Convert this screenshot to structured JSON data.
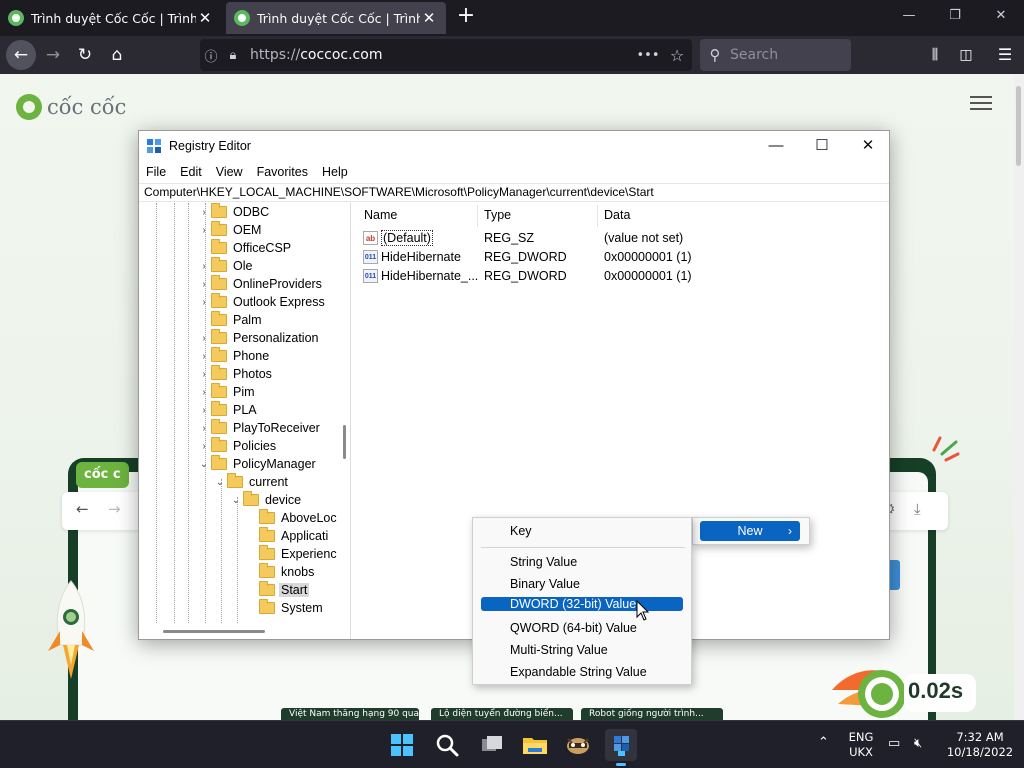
{
  "browser": {
    "tabs": [
      {
        "title": "Trình duyệt Cốc Cốc | Trình duy",
        "active": false
      },
      {
        "title": "Trình duyệt Cốc Cốc | Trình duy",
        "active": true
      }
    ],
    "url_scheme": "https://",
    "url_host": "coccoc.com",
    "search_placeholder": "Search"
  },
  "page": {
    "logo_text": "cốc cốc",
    "mock_logo": "cốc c",
    "speed_value": "0.02s",
    "news": [
      "Việt Nam thăng hạng 90 qua...",
      "Lộ diện tuyển đường biển...",
      "Robot giống người trình..."
    ]
  },
  "regedit": {
    "title": "Registry Editor",
    "menu": [
      "File",
      "Edit",
      "View",
      "Favorites",
      "Help"
    ],
    "address": "Computer\\HKEY_LOCAL_MACHINE\\SOFTWARE\\Microsoft\\PolicyManager\\current\\device\\Start",
    "tree": [
      {
        "label": "ODBC",
        "level": 0,
        "expander": "›"
      },
      {
        "label": "OEM",
        "level": 0,
        "expander": "›"
      },
      {
        "label": "OfficeCSP",
        "level": 0,
        "expander": ""
      },
      {
        "label": "Ole",
        "level": 0,
        "expander": "›"
      },
      {
        "label": "OnlineProviders",
        "level": 0,
        "expander": "›"
      },
      {
        "label": "Outlook Express",
        "level": 0,
        "expander": "›"
      },
      {
        "label": "Palm",
        "level": 0,
        "expander": ""
      },
      {
        "label": "Personalization",
        "level": 0,
        "expander": "›"
      },
      {
        "label": "Phone",
        "level": 0,
        "expander": "›"
      },
      {
        "label": "Photos",
        "level": 0,
        "expander": "›"
      },
      {
        "label": "Pim",
        "level": 0,
        "expander": "›"
      },
      {
        "label": "PLA",
        "level": 0,
        "expander": "›"
      },
      {
        "label": "PlayToReceiver",
        "level": 0,
        "expander": "›"
      },
      {
        "label": "Policies",
        "level": 0,
        "expander": "›"
      },
      {
        "label": "PolicyManager",
        "level": 0,
        "expander": "⌄"
      },
      {
        "label": "current",
        "level": 1,
        "expander": "⌄"
      },
      {
        "label": "device",
        "level": 2,
        "expander": "⌄"
      },
      {
        "label": "AboveLoc",
        "level": 3,
        "expander": ""
      },
      {
        "label": "Applicati",
        "level": 3,
        "expander": ""
      },
      {
        "label": "Experienc",
        "level": 3,
        "expander": ""
      },
      {
        "label": "knobs",
        "level": 3,
        "expander": ""
      },
      {
        "label": "Start",
        "level": 3,
        "expander": "",
        "selected": true
      },
      {
        "label": "System",
        "level": 3,
        "expander": ""
      }
    ],
    "columns": {
      "name": "Name",
      "type": "Type",
      "data": "Data"
    },
    "values": [
      {
        "name": "(Default)",
        "type": "REG_SZ",
        "data": "(value not set)",
        "icon": "ab"
      },
      {
        "name": "HideHibernate",
        "type": "REG_DWORD",
        "data": "0x00000001 (1)",
        "icon": "bin"
      },
      {
        "name": "HideHibernate_...",
        "type": "REG_DWORD",
        "data": "0x00000001 (1)",
        "icon": "bin"
      }
    ]
  },
  "context_menu": {
    "key": "Key",
    "new_label": "New",
    "submenu": [
      "String Value",
      "Binary Value",
      "DWORD (32-bit) Value",
      "QWORD (64-bit) Value",
      "Multi-String Value",
      "Expandable String Value"
    ],
    "highlighted": "DWORD (32-bit) Value"
  },
  "taskbar": {
    "lang_1": "ENG",
    "lang_2": "UKX",
    "time": "7:32 AM",
    "date": "10/18/2022"
  },
  "colors": {
    "accent": "#0a64c2",
    "coccoc_green": "#6cb33f",
    "browser_bg": "#1c1b22"
  }
}
